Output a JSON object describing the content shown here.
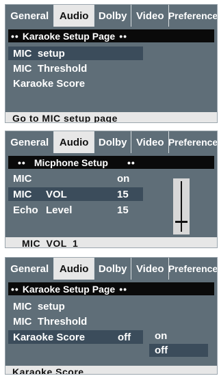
{
  "tabs": [
    "General",
    "Audio",
    "Dolby",
    "Video",
    "Preference"
  ],
  "active_tab": "Audio",
  "panel1": {
    "header_prefix": "••",
    "header_title": "Karaoke Setup Page",
    "header_suffix": "••",
    "items": [
      "MIC  setup",
      "MIC  Threshold",
      "Karaoke Score"
    ],
    "selected_index": 0,
    "footer": "Go to MIC setup page"
  },
  "panel2": {
    "header_prefix": "••",
    "header_title": "Micphone Setup",
    "header_suffix": "••",
    "rows": [
      {
        "label": "MIC",
        "mid": "",
        "value": "on"
      },
      {
        "label": "MIC",
        "mid": "VOL",
        "value": "15"
      },
      {
        "label": "Echo",
        "mid": "Level",
        "value": "15"
      }
    ],
    "selected_index": 1,
    "slider_level": 0.2,
    "footer": "MIC VOL 1"
  },
  "panel3": {
    "header_prefix": "••",
    "header_title": "Karaoke Setup Page",
    "header_suffix": "••",
    "items": [
      "MIC  setup",
      "MIC  Threshold",
      "Karaoke Score"
    ],
    "item3_value": "off",
    "selected_index": 2,
    "popup_options": [
      "on",
      "off"
    ],
    "popup_selected_index": 1,
    "footer": "Karaoke Score"
  },
  "colors": {
    "panel_bg": "#5f6e78",
    "tab_active_bg": "#e7e7e7",
    "header_bg": "#0a0a0a",
    "selection_bg": "#3b4c5b",
    "text": "#ffffff"
  }
}
